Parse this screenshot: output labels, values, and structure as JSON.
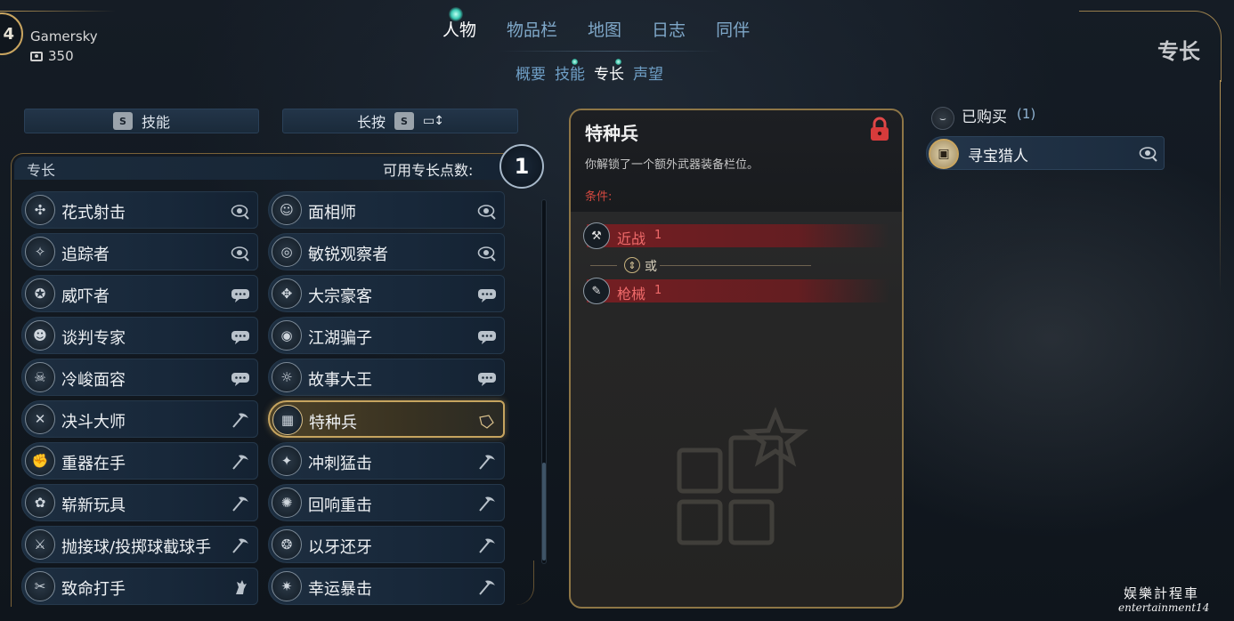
{
  "profile": {
    "level": "4",
    "name": "Gamersky",
    "currency": "350"
  },
  "nav": {
    "tabs": [
      "人物",
      "物品栏",
      "地图",
      "日志",
      "同伴"
    ],
    "active_tab": "人物",
    "sub_tabs": [
      "概要",
      "技能",
      "专长",
      "声望"
    ],
    "active_sub_tab": "专长"
  },
  "page_title": "专长",
  "toolbar": {
    "skills_key": "S",
    "skills_label": "技能",
    "sort_label": "长按",
    "sort_key": "S",
    "sort_icon": "sort-icon"
  },
  "perks_panel": {
    "header": "专长",
    "points_label": "可用专长点数:",
    "points": "1",
    "perks": [
      {
        "name": "花式射击",
        "type_icon": "inspect-icon",
        "selected": false
      },
      {
        "name": "面相师",
        "type_icon": "inspect-icon",
        "selected": false
      },
      {
        "name": "追踪者",
        "type_icon": "inspect-icon",
        "selected": false
      },
      {
        "name": "敏锐观察者",
        "type_icon": "inspect-icon",
        "selected": false
      },
      {
        "name": "威吓者",
        "type_icon": "dialogue-icon",
        "selected": false
      },
      {
        "name": "大宗豪客",
        "type_icon": "dialogue-icon",
        "selected": false
      },
      {
        "name": "谈判专家",
        "type_icon": "dialogue-icon",
        "selected": false
      },
      {
        "name": "江湖骗子",
        "type_icon": "dialogue-icon",
        "selected": false
      },
      {
        "name": "冷峻面容",
        "type_icon": "dialogue-icon",
        "selected": false
      },
      {
        "name": "故事大王",
        "type_icon": "dialogue-icon",
        "selected": false
      },
      {
        "name": "决斗大师",
        "type_icon": "melee-icon",
        "selected": false
      },
      {
        "name": "特种兵",
        "type_icon": "combat-icon",
        "selected": true
      },
      {
        "name": "重器在手",
        "type_icon": "melee-icon",
        "selected": false
      },
      {
        "name": "冲刺猛击",
        "type_icon": "melee-icon",
        "selected": false
      },
      {
        "name": "崭新玩具",
        "type_icon": "melee-icon",
        "selected": false
      },
      {
        "name": "回响重击",
        "type_icon": "melee-icon",
        "selected": false
      },
      {
        "name": "抛接球/投掷球截球手",
        "type_icon": "melee-icon",
        "selected": false
      },
      {
        "name": "以牙还牙",
        "type_icon": "melee-icon",
        "selected": false
      },
      {
        "name": "致命打手",
        "type_icon": "fist-icon",
        "selected": false
      },
      {
        "name": "幸运暴击",
        "type_icon": "melee-icon",
        "selected": false
      }
    ]
  },
  "detail": {
    "title": "特种兵",
    "locked": true,
    "description": "你解锁了一个额外武器装备栏位。",
    "conditions_label": "条件:",
    "requirements": [
      {
        "name": "近战",
        "level": "1",
        "icon": "melee-weapon-icon"
      },
      {
        "name": "枪械",
        "level": "1",
        "icon": "gun-icon"
      }
    ],
    "or_label": "或"
  },
  "purchased": {
    "label": "已购买",
    "count": "(1)",
    "items": [
      {
        "name": "寻宝猎人"
      }
    ]
  },
  "watermark": {
    "cn": "娱樂計程車",
    "en": "entertainment14"
  },
  "colors": {
    "accent_gold": "#c6a45f",
    "requirement_red": "#ef6a6a",
    "nav_blue": "#7fa8c9"
  }
}
